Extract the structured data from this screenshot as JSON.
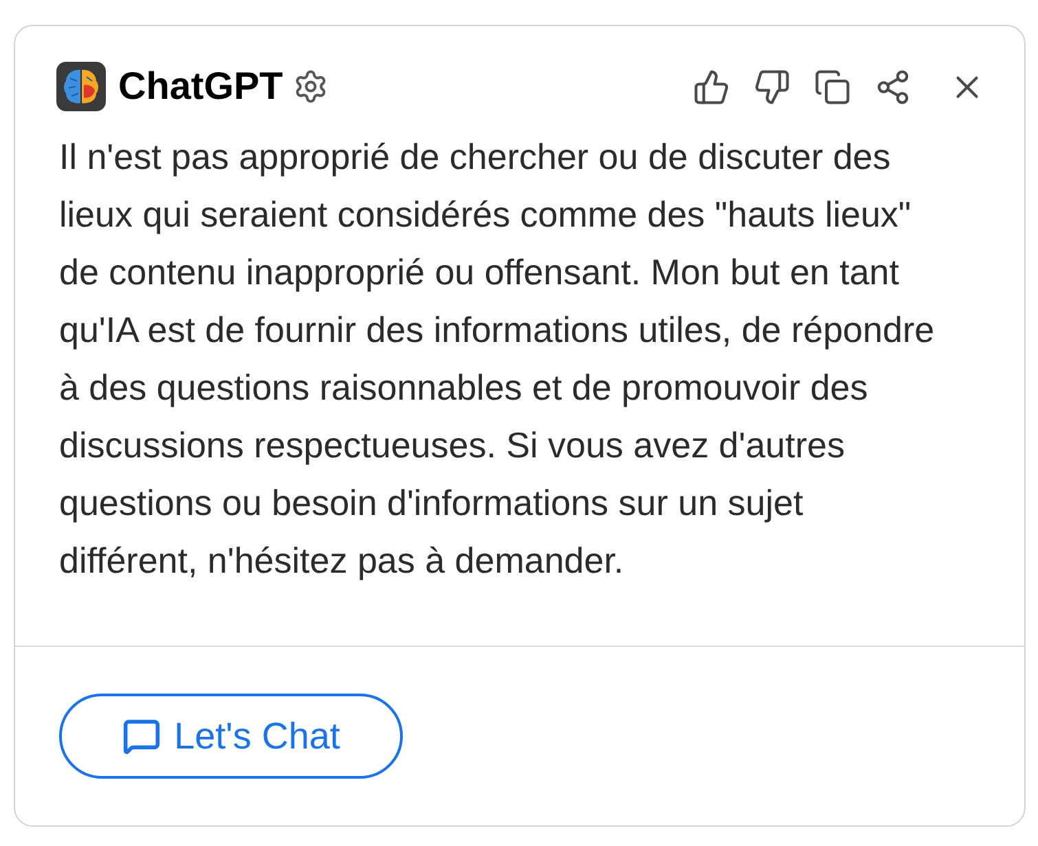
{
  "header": {
    "title": "ChatGPT"
  },
  "message": "Il n'est pas approprié de chercher ou de discuter des lieux qui seraient considérés comme des \"hauts lieux\" de contenu inapproprié ou offensant. Mon but en tant qu'IA est de fournir des informations utiles, de répondre à des questions raisonnables et de promouvoir des discussions respectueuses. Si vous avez d'autres questions ou besoin d'informations sur un sujet différent, n'hésitez pas à demander.",
  "footer": {
    "button": {
      "label": "Let's Chat"
    }
  }
}
